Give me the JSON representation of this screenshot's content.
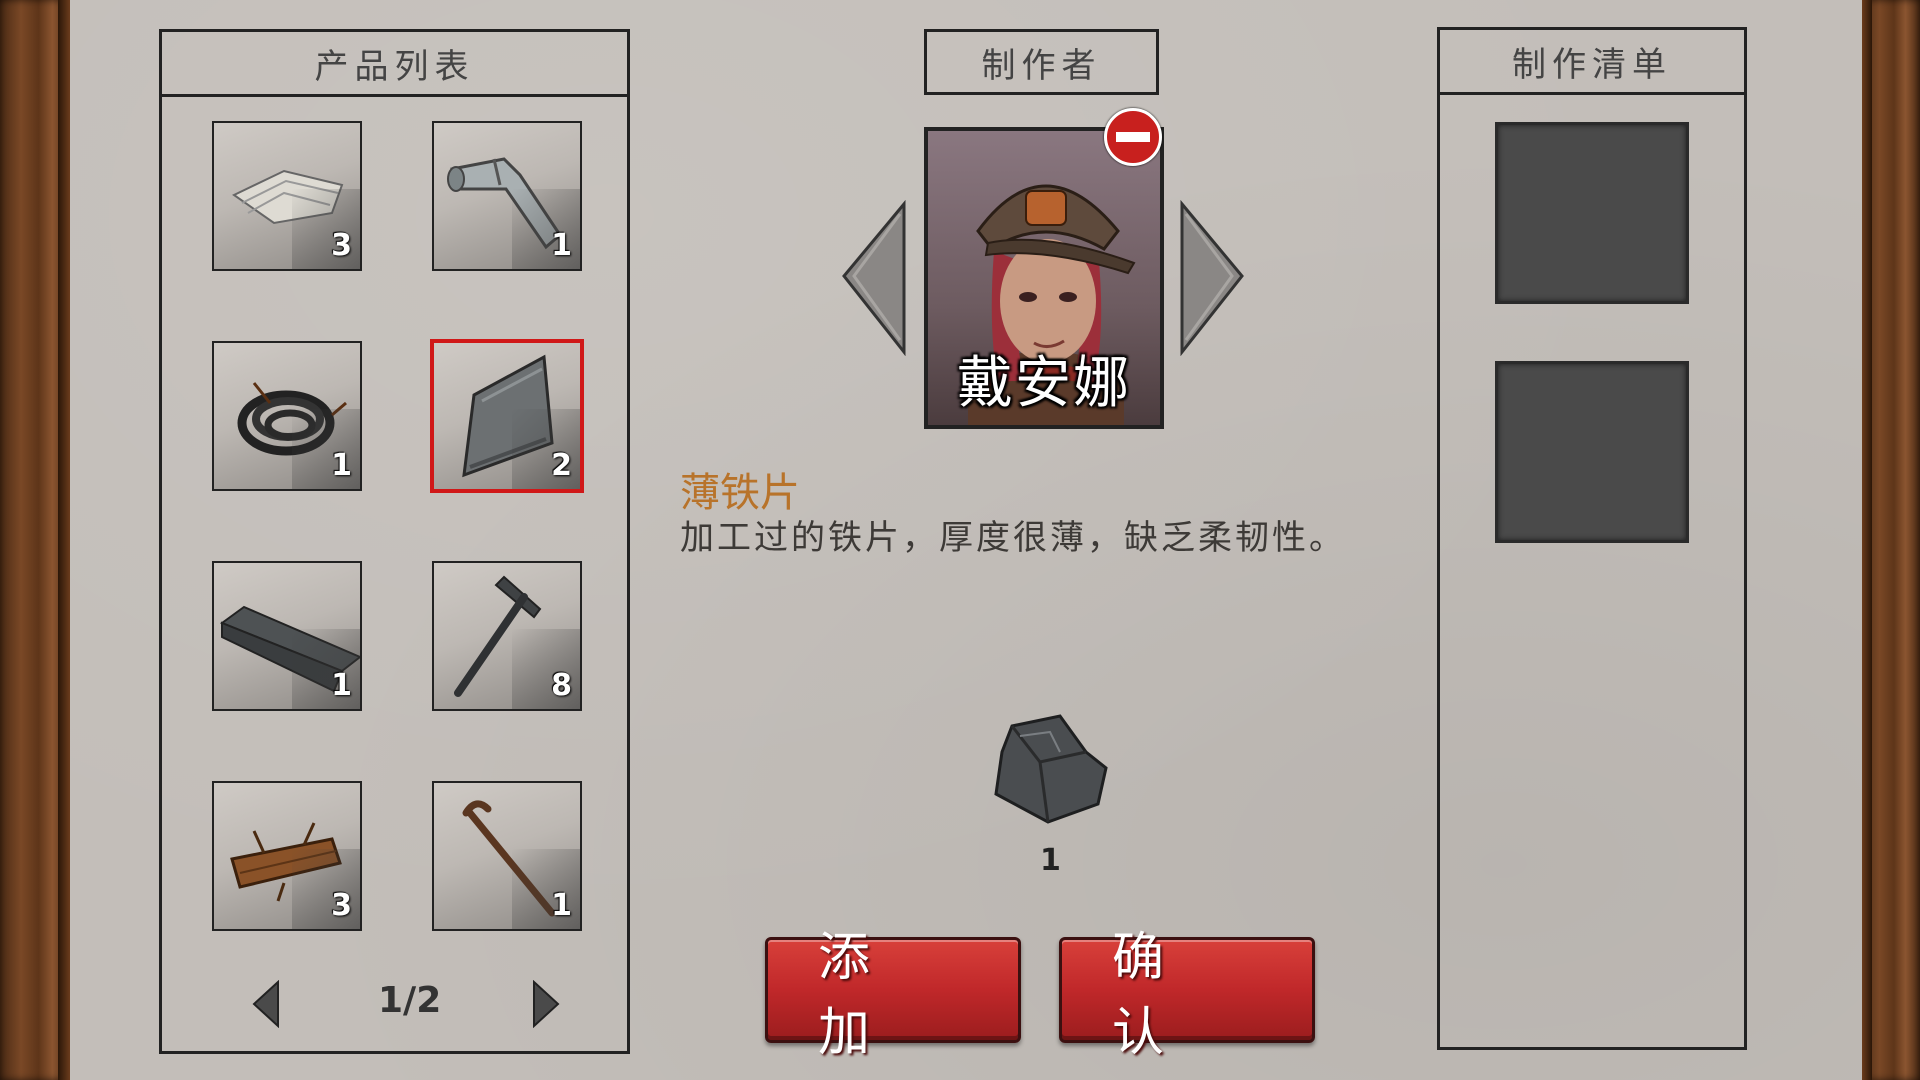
{
  "product_list": {
    "title": "产品列表",
    "items": [
      {
        "icon": "cloth-icon",
        "count": "3",
        "selected": false
      },
      {
        "icon": "pipe-icon",
        "count": "1",
        "selected": false
      },
      {
        "icon": "hose-icon",
        "count": "1",
        "selected": false
      },
      {
        "icon": "iron-sheet-icon",
        "count": "2",
        "selected": true
      },
      {
        "icon": "angle-iron-icon",
        "count": "1",
        "selected": false
      },
      {
        "icon": "hammer-icon",
        "count": "8",
        "selected": false
      },
      {
        "icon": "wood-log-icon",
        "count": "3",
        "selected": false
      },
      {
        "icon": "crowbar-icon",
        "count": "1",
        "selected": false
      }
    ],
    "pager": "1/2"
  },
  "maker": {
    "title": "制作者",
    "name": "戴安娜"
  },
  "selected_item": {
    "name": "薄铁片",
    "description": "加工过的铁片，厚度很薄，缺乏柔韧性。",
    "material_icon": "iron-ore-icon",
    "material_count": "1"
  },
  "buttons": {
    "add": "添加",
    "confirm": "确认"
  },
  "craft_list": {
    "title": "制作清单"
  },
  "colors": {
    "background": "#c3beb9",
    "selection": "#d01818",
    "item_name": "#b8732a",
    "button": "#c0282a"
  }
}
